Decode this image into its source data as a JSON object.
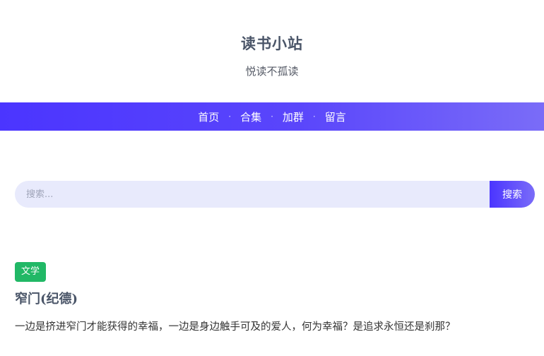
{
  "site": {
    "title": "读书小站",
    "subtitle": "悦读不孤读"
  },
  "nav": {
    "items": [
      {
        "label": "首页"
      },
      {
        "label": "合集"
      },
      {
        "label": "加群"
      },
      {
        "label": "留言"
      }
    ],
    "separator": "·"
  },
  "search": {
    "placeholder": "搜索...",
    "button_label": "搜索"
  },
  "post": {
    "tag": "文学",
    "title": "窄门(纪德)",
    "excerpt": "一边是挤进窄门才能获得的幸福，一边是身边触手可及的爱人，何为幸福？是追求永恒还是刹那？"
  },
  "colors": {
    "accent": "#4b35ff",
    "accent_end": "#7a6cf8",
    "tag_green": "#21b866",
    "search_bg": "#e8eafc"
  }
}
